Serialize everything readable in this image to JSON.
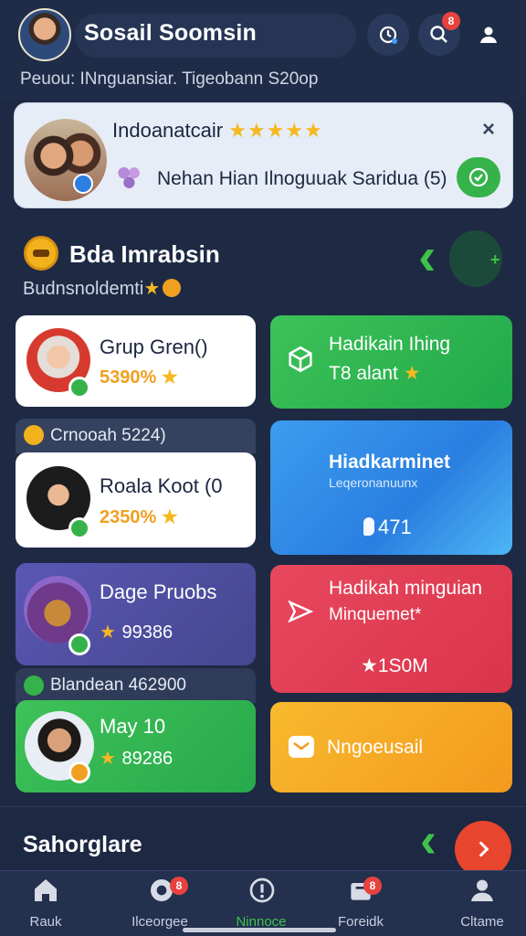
{
  "header": {
    "app_title": "Sosail Soomsin",
    "subtitle": "Peuou: INnguansiar. Tigeobann S20op",
    "notification_count": "8"
  },
  "notification": {
    "name": "Indoanatcair",
    "stars": "★★★★★",
    "message": "Nehan Hian Ilnoguuak Saridua (5)",
    "close": "×"
  },
  "section": {
    "title": "Bda Imrabsin",
    "subtitle": "Budnsnoldemti"
  },
  "cards": {
    "c1": {
      "title": "Grup Gren()",
      "value": "5390%"
    },
    "c2": {
      "title": "Hadikain Ihing",
      "value": "T8 alant"
    },
    "band1": {
      "text": "Crnooah 5224)"
    },
    "c3": {
      "title": "Roala Koot (0",
      "value": "2350%"
    },
    "c4": {
      "title": "Hiadkarminet",
      "sub": "Leqeronanuunx",
      "value": "471"
    },
    "c5": {
      "title": "Dage Pruobs",
      "value": "99386"
    },
    "c6": {
      "title": "Hadikah minguian",
      "sub": "Minquemet*",
      "value": "1S0M"
    },
    "band2": {
      "text": "Blandean 462900"
    },
    "c7": {
      "title": "May 10",
      "value": "89286"
    },
    "c8": {
      "title": "Nngoeusail"
    }
  },
  "section2": {
    "title": "Sahorglare"
  },
  "nav": {
    "items": [
      {
        "label": "Rauk",
        "icon": "home-icon",
        "badge": ""
      },
      {
        "label": "Ilceorgee",
        "icon": "chat-icon",
        "badge": "8"
      },
      {
        "label": "Ninnoce",
        "icon": "info-icon",
        "badge": ""
      },
      {
        "label": "Foreidk",
        "icon": "box-icon",
        "badge": "8"
      },
      {
        "label": "Cltame",
        "icon": "profile-icon",
        "badge": ""
      }
    ]
  },
  "colors": {
    "background": "#1e2a44",
    "green": "#36b24a",
    "blue": "#2f8fe8",
    "red": "#e83c4e",
    "purple": "#4b4d9e",
    "orange": "#f5a623"
  }
}
